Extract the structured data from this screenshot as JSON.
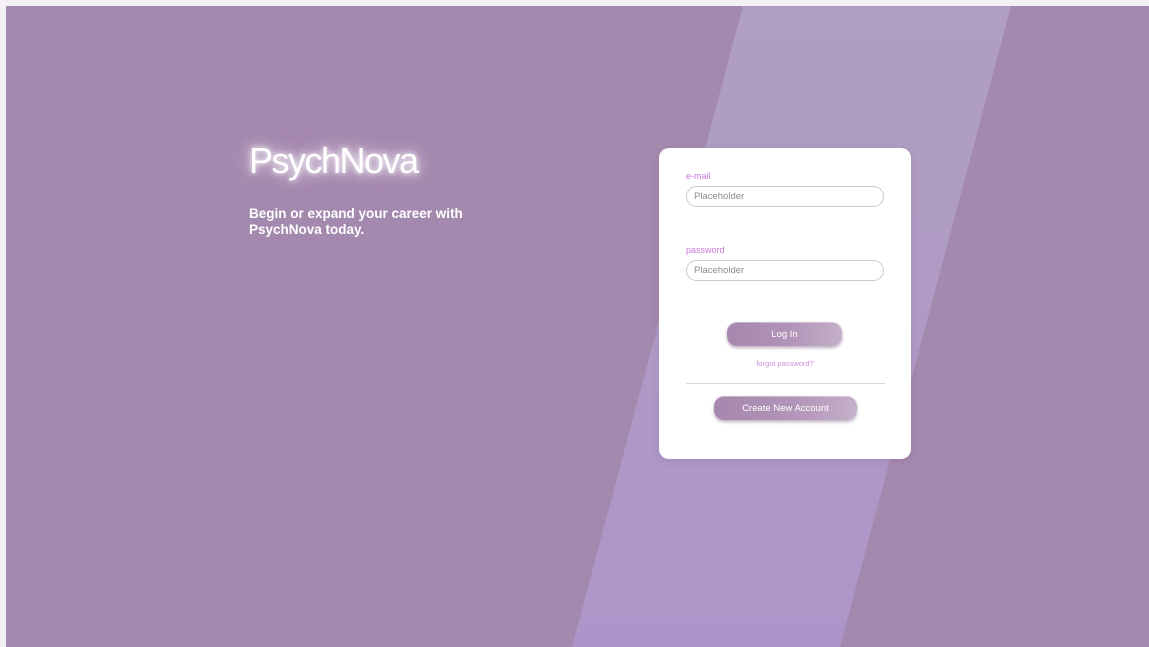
{
  "brand": {
    "name": "PsychNova",
    "tagline": "Begin or expand your career with PsychNova today."
  },
  "login_form": {
    "email_label": "e-mail",
    "email_placeholder": "Placeholder",
    "password_label": "password",
    "password_placeholder": "Placeholder",
    "login_button": "Log In",
    "forgot_link": "forgot password?",
    "create_account_button": "Create New Account"
  },
  "colors": {
    "background": "#a489ae",
    "band": "#b09ac3",
    "card": "#ffffff",
    "label_accent": "#c779d9",
    "button": "#a687ad"
  }
}
